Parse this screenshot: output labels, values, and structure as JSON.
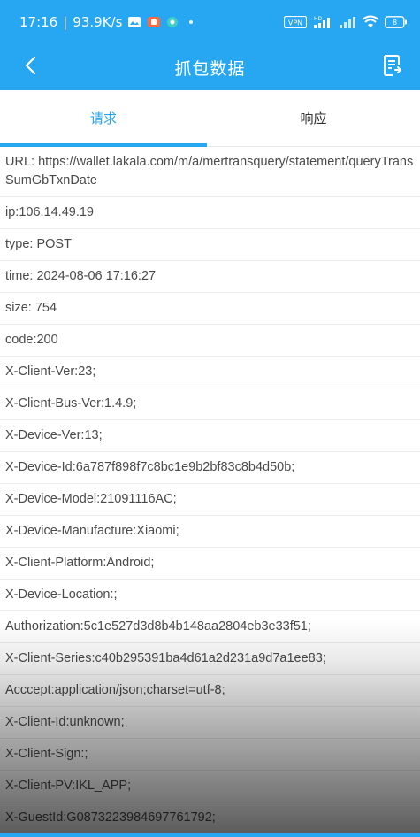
{
  "status_bar": {
    "time": "17:16",
    "speed": "93.9K/s",
    "vpn": "VPN",
    "hd": "HD",
    "battery": "8"
  },
  "app_bar": {
    "title": "抓包数据",
    "back_icon": "back-arrow-icon",
    "menu_icon": "document-list-icon"
  },
  "tabs": [
    {
      "label": "请求",
      "active": true
    },
    {
      "label": "响应",
      "active": false
    }
  ],
  "request_fields": [
    "URL: https://wallet.lakala.com/m/a/mertransquery/statement/queryTransSumGbTxnDate",
    "ip:106.14.49.19",
    "type: POST",
    "time: 2024-08-06 17:16:27",
    "size: 754",
    "code:200",
    "X-Client-Ver:23;",
    "X-Client-Bus-Ver:1.4.9;",
    "X-Device-Ver:13;",
    "X-Device-Id:6a787f898f7c8bc1e9b2bf83c8b4d50b;",
    "X-Device-Model:21091116AC;",
    "X-Device-Manufacture:Xiaomi;",
    "X-Client-Platform:Android;",
    "X-Device-Location:;",
    "Authorization:5c1e527d3d8b4b148aa2804eb3e33f51;",
    "X-Client-Series:c40b295391ba4d61a2d231a9d7a1ee83;",
    "Acccept:application/json;charset=utf-8;",
    "X-Client-Id:unknown;",
    "X-Client-Sign:;",
    "X-Client-PV:IKL_APP;",
    "X-GuestId:G087322398469776179​2;"
  ],
  "colors": {
    "primary": "#27a6f1",
    "text": "#4a4a4a",
    "divider": "#ececec"
  }
}
